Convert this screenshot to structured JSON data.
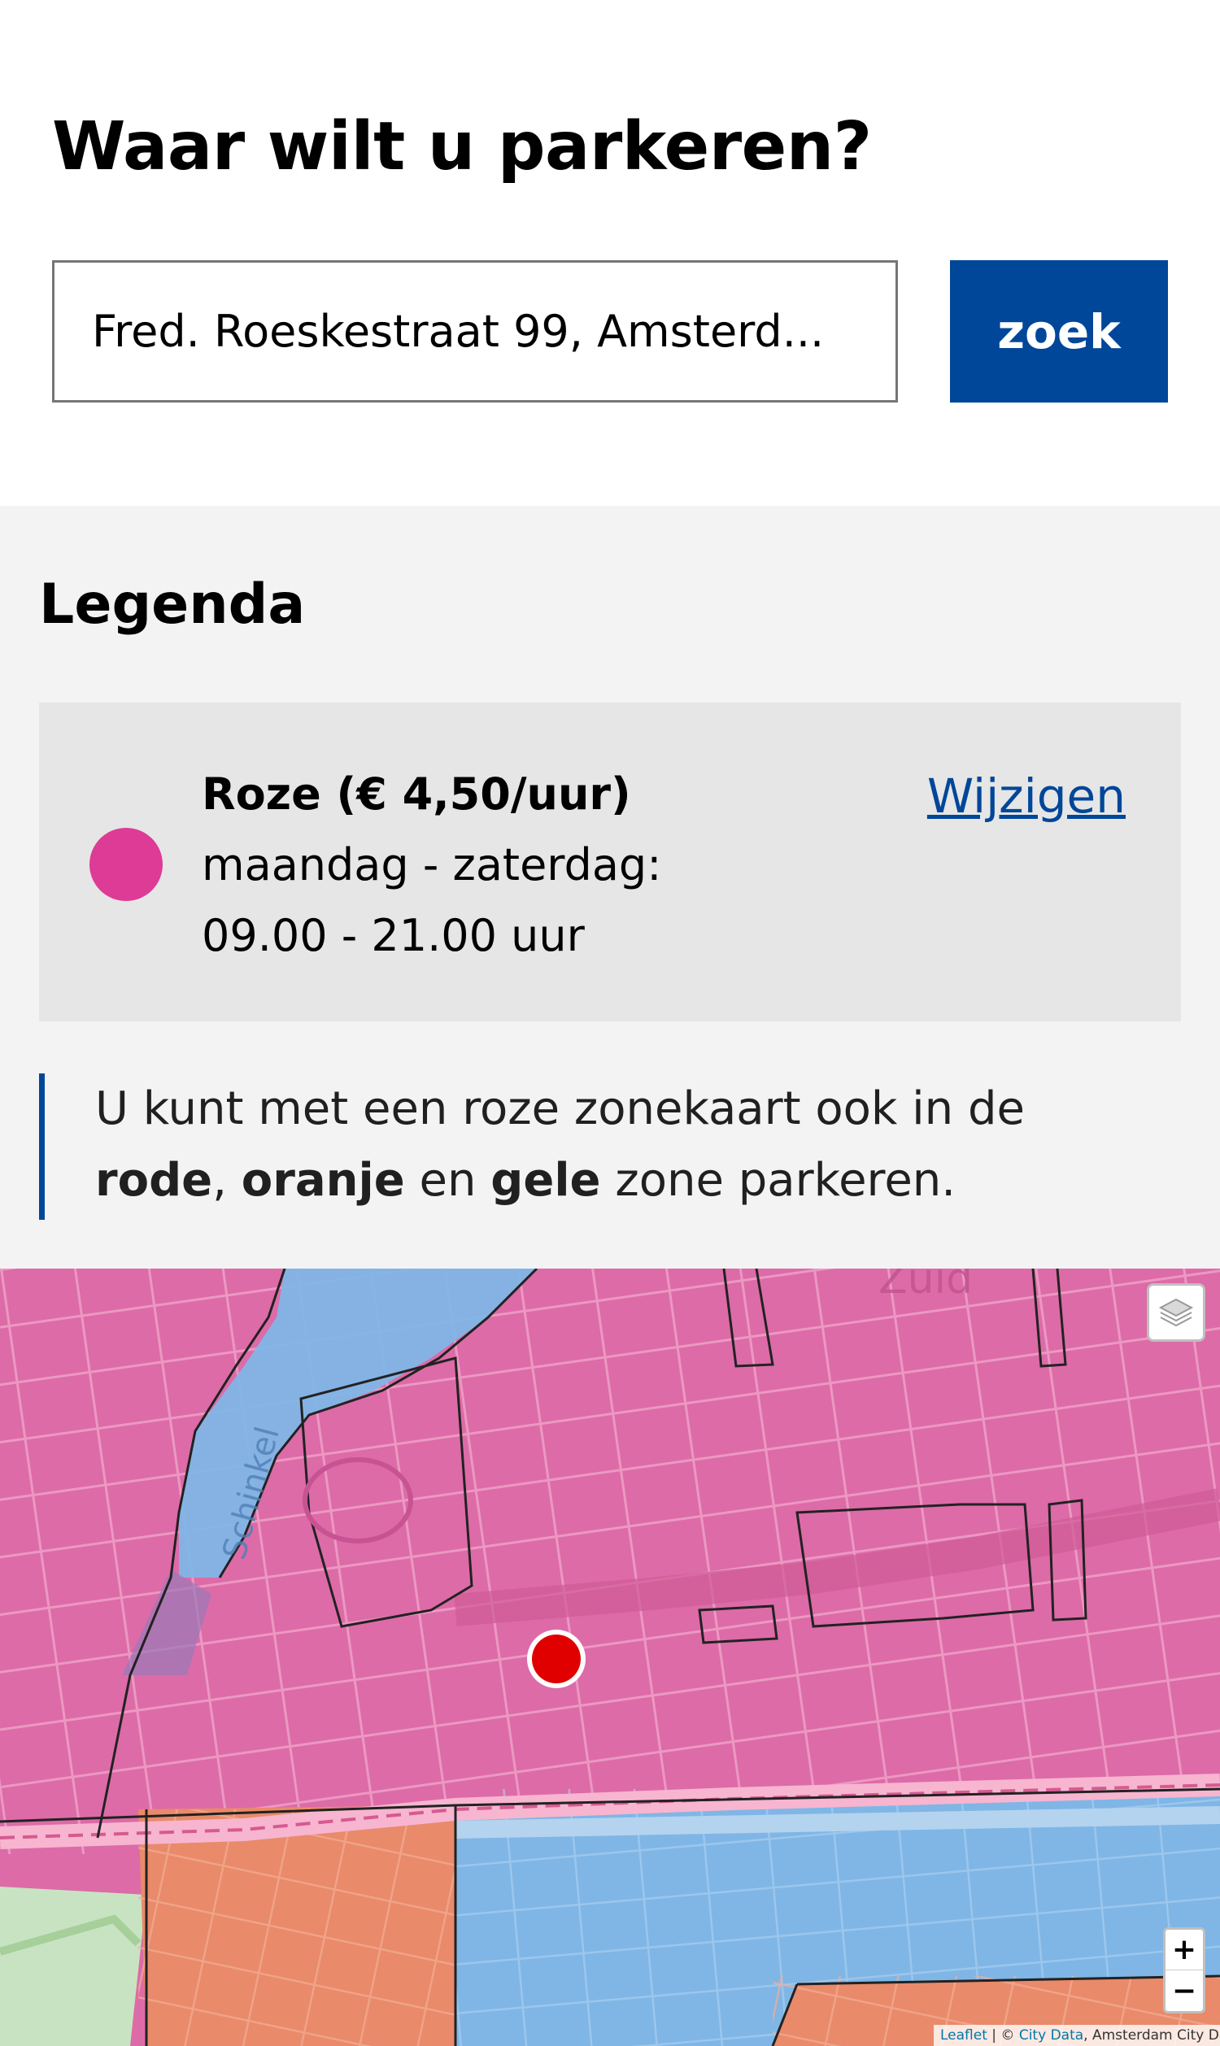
{
  "header": {
    "title": "Waar wilt u parkeren?",
    "search_value": "Fred. Roeskestraat 99, Amsterd...",
    "search_button": "zoek"
  },
  "legend": {
    "title": "Legenda",
    "zone": {
      "name": "Roze (€ 4,50/uur)",
      "days": "maandag - zaterdag:",
      "hours": "09.00 - 21.00 uur",
      "color": "#dd3b96"
    },
    "change_link": "Wijzigen"
  },
  "info": {
    "line1": "U kunt met een roze zonekaart ook in de",
    "rode": "rode",
    "comma": ",",
    "oranje": "oranje",
    "en": "en",
    "gele": "gele",
    "rest": "zone parkeren."
  },
  "map": {
    "labels": {
      "district": "Zuid",
      "canal": "Schinkel"
    },
    "zone_colors": {
      "pink": "#dd6ba8",
      "blue": "#7fb6e6",
      "orange": "#e98a6a"
    },
    "marker_color": "#e00000",
    "zoom_in": "+",
    "zoom_out": "−",
    "attribution": {
      "leaflet": "Leaflet",
      "sep": " | © ",
      "citydata": "City Data",
      "rest": ", Amsterdam City Data"
    }
  },
  "colors": {
    "primary": "#004699",
    "legend_bg": "#f3f3f3",
    "card_bg": "#e6e6e6"
  }
}
